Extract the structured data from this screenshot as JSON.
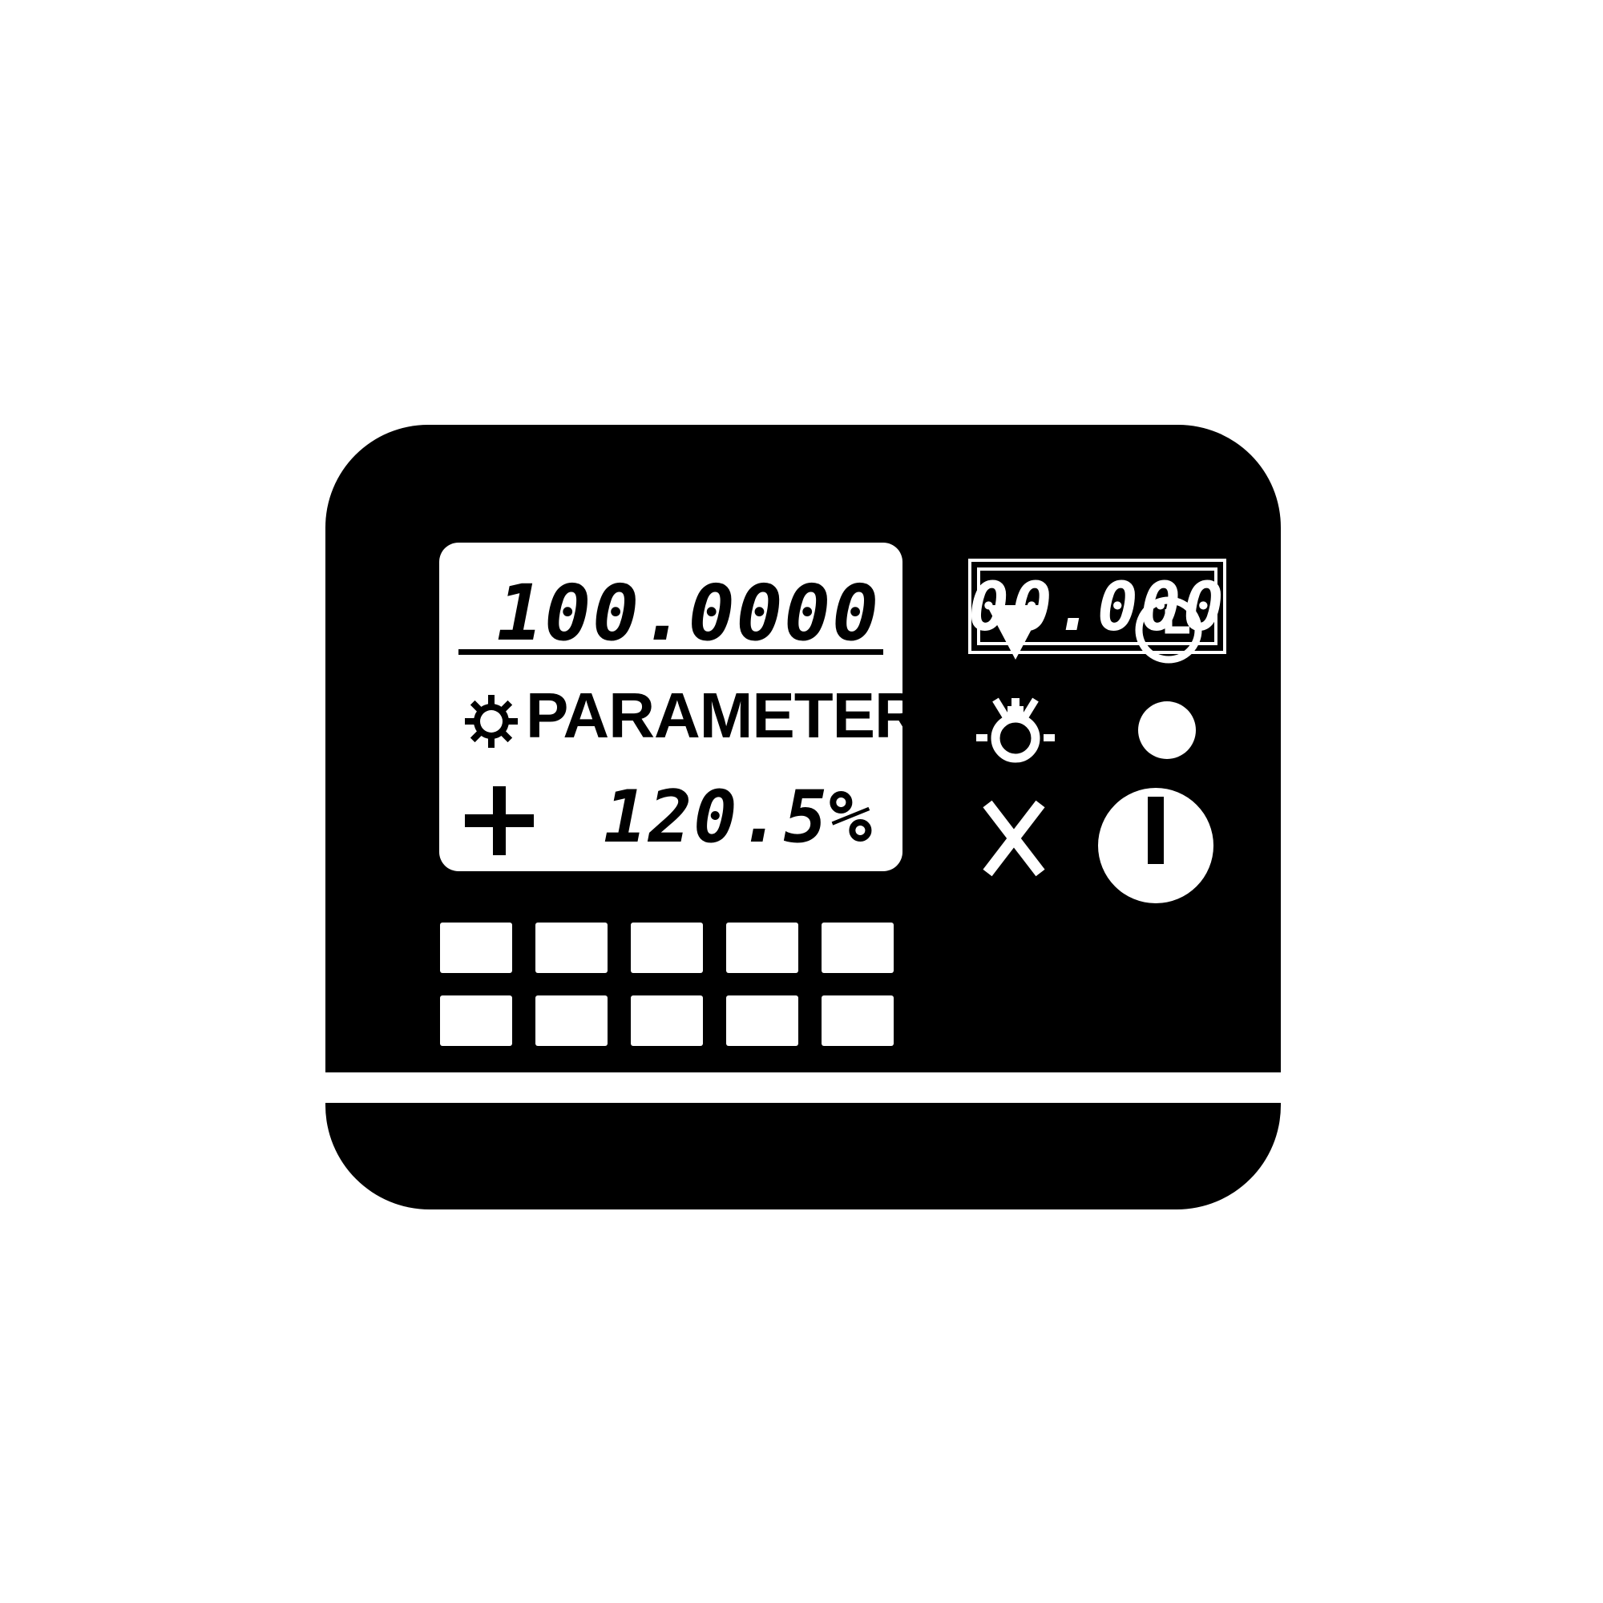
{
  "display": {
    "main_value": "100.0000",
    "label": "PARAMETER",
    "percent_value": "120.5%"
  },
  "counter": {
    "value": "00.000"
  },
  "controls": {
    "icons": [
      "gear-icon",
      "plus-icon",
      "down-arrow-icon",
      "timer-icon",
      "wrench-icon",
      "dot-icon",
      "close-icon",
      "power-icon"
    ]
  },
  "keypad": {
    "rows": 2,
    "columns": 5
  },
  "colors": {
    "body": "#000000",
    "display": "#ffffff"
  }
}
